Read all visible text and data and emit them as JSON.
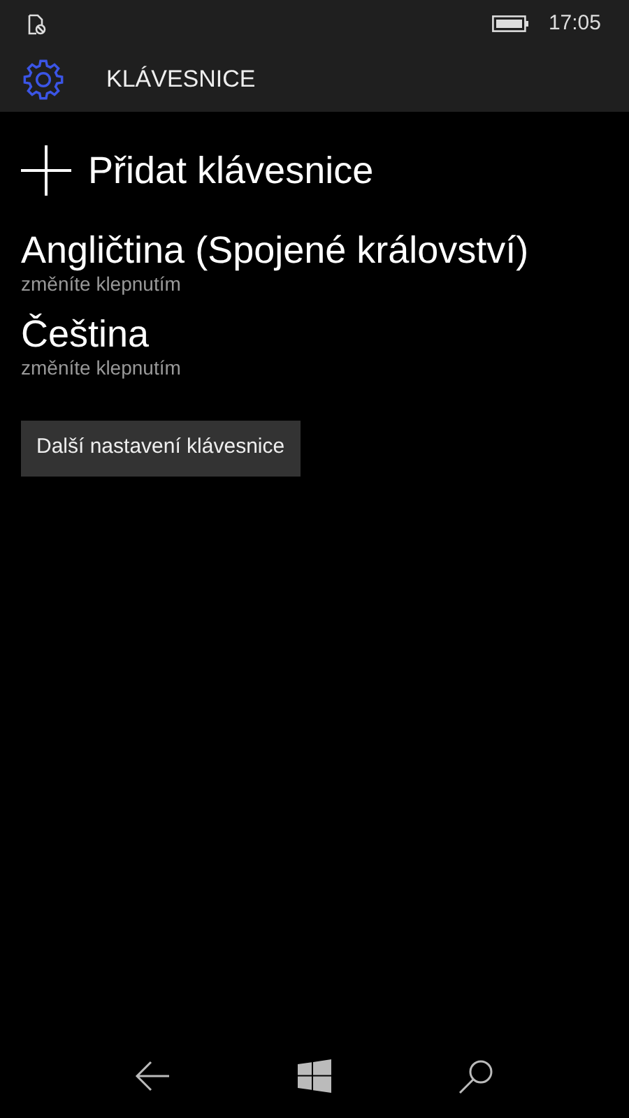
{
  "status_bar": {
    "time": "17:05"
  },
  "header": {
    "title": "KLÁVESNICE"
  },
  "add_action": {
    "label": "Přidat klávesnice"
  },
  "keyboards": [
    {
      "name": "Angličtina (Spojené království)",
      "hint": "změníte klepnutím"
    },
    {
      "name": "Čeština",
      "hint": "změníte klepnutím"
    }
  ],
  "button": {
    "label": "Další nastavení klávesnice"
  }
}
